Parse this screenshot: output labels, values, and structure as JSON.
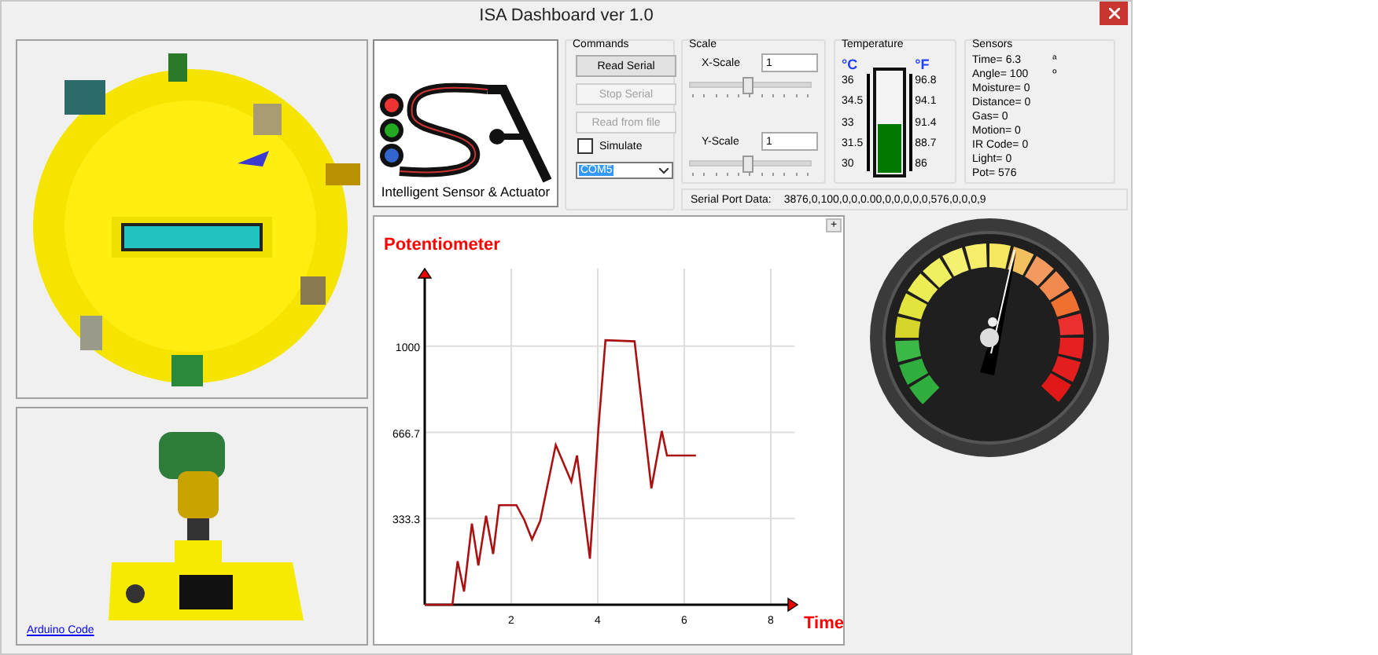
{
  "window": {
    "title": "ISA Dashboard ver 1.0"
  },
  "photos": [
    {
      "kind": "picture"
    },
    {
      "kind": "picture",
      "link": "Arduino Code"
    }
  ],
  "logo": {
    "caption": "Intelligent Sensor & Actuator"
  },
  "commands": {
    "title": "Commands",
    "buttons": [
      {
        "label": "Read Serial",
        "disabled": false
      },
      {
        "label": "Stop Serial",
        "disabled": true
      },
      {
        "label": "Read from file",
        "disabled": true
      }
    ],
    "simulate": {
      "label": "Simulate",
      "checked": false
    },
    "port": "COM5"
  },
  "scale": {
    "title": "Scale",
    "sliders": [
      {
        "label": "X-Scale",
        "value": "1",
        "level": 0.48
      },
      {
        "label": "Y-Scale",
        "value": "1",
        "level": 0.48
      }
    ]
  },
  "temperature": {
    "title": "Temperature",
    "celsius_unit": "°C",
    "fahrenheit_unit": "°F",
    "celsius_ticks": [
      "36",
      "34.5",
      "33",
      "31.5",
      "30"
    ],
    "fahrenheit_ticks": [
      "96.8",
      "94.1",
      "91.4",
      "88.7",
      "86"
    ],
    "level": 0.5
  },
  "sensors": {
    "title": "Sensors",
    "readings": [
      "Time= 6.3",
      "Angle= 100",
      "Moisture=  0",
      "Distance=  0",
      "Gas=  0",
      "Motion=  0",
      "IR Code=  0",
      "Light=  0",
      "Pot=  576"
    ],
    "marks": [
      "ª",
      "º"
    ]
  },
  "serial": {
    "label": "Serial Port Data:",
    "value": "3876,0,100,0,0,0.00,0,0,0,0,0,576,0,0,0,9"
  },
  "chart": {
    "expand_button": "+",
    "chart_data": {
      "type": "line",
      "title": "Potentiometer",
      "xlabel": "Time",
      "xlim": [
        0,
        8.4
      ],
      "grid": true,
      "ylim": [
        0,
        1300
      ],
      "xticks": [
        2,
        4,
        6,
        8
      ],
      "yticks": [
        {
          "value": 333.3,
          "label": "333.3"
        },
        {
          "value": 666.7,
          "label": "666.7"
        },
        {
          "value": 1000,
          "label": "1000"
        }
      ],
      "x": [
        0,
        0.64,
        0.76,
        0.91,
        1.09,
        1.24,
        1.42,
        1.58,
        1.72,
        2.12,
        2.3,
        2.48,
        2.67,
        3.03,
        3.39,
        3.52,
        3.82,
        4.02,
        4.18,
        4.85,
        5.24,
        5.48,
        5.6,
        6.27
      ],
      "series": [
        {
          "color": "#aa1111",
          "values": [
            0,
            0,
            168,
            51,
            314,
            152,
            344,
            196,
            385,
            385,
            328,
            253,
            324,
            618,
            476,
            577,
            178,
            689,
            1023,
            1019,
            450,
            672,
            577,
            577
          ]
        }
      ]
    }
  },
  "gauge": {
    "kind": "picture"
  }
}
